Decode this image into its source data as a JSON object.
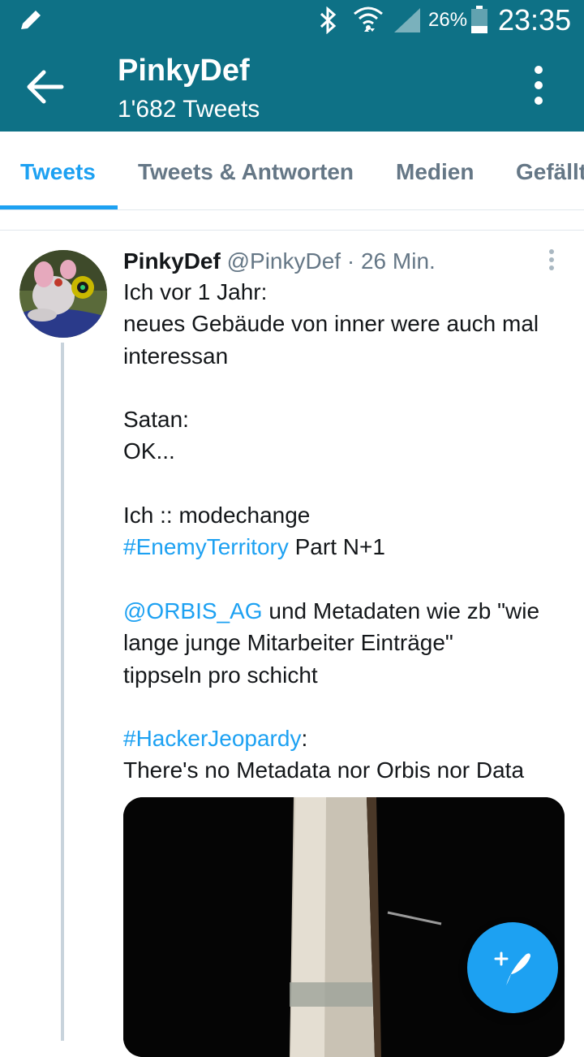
{
  "status_bar": {
    "battery_percent": "26%",
    "time": "23:35",
    "icons": [
      "pencil-icon",
      "bluetooth-icon",
      "wifi-icon",
      "signal-icon",
      "battery-icon"
    ]
  },
  "app_bar": {
    "title": "PinkyDef",
    "subtitle": "1'682 Tweets",
    "back_icon": "arrow-left-icon",
    "overflow_icon": "more-vertical-icon"
  },
  "tabs": [
    {
      "label": "Tweets",
      "active": true
    },
    {
      "label": "Tweets & Antworten",
      "active": false
    },
    {
      "label": "Medien",
      "active": false
    },
    {
      "label": "Gefällt",
      "active": false
    }
  ],
  "tweet": {
    "author_name": "PinkyDef",
    "author_handle": "@PinkyDef",
    "separator": "·",
    "time": "26 Min.",
    "lines": {
      "l1": "Ich vor 1 Jahr:",
      "l2": "neues Gebäude von inner were auch mal",
      "l3": "interessan",
      "l4": "Satan:",
      "l5": "OK...",
      "l6": "Ich :: modechange",
      "l7_link": "#EnemyTerritory",
      "l7_rest": " Part N+1",
      "l8_link": "@ORBIS_AG",
      "l8_rest": " und Metadaten wie zb \"wie",
      "l9": "lange junge Mitarbeiter Einträge\"",
      "l10": "tippseln pro schicht",
      "l11_link": "#HackerJeopardy",
      "l11_rest": ":",
      "l12": "There's no Metadata nor Orbis nor Data"
    }
  },
  "colors": {
    "header_bg": "#0e7186",
    "accent": "#1da1f2",
    "text": "#14171a",
    "secondary_text": "#657786"
  },
  "fab": {
    "icon": "compose-tweet-icon"
  }
}
